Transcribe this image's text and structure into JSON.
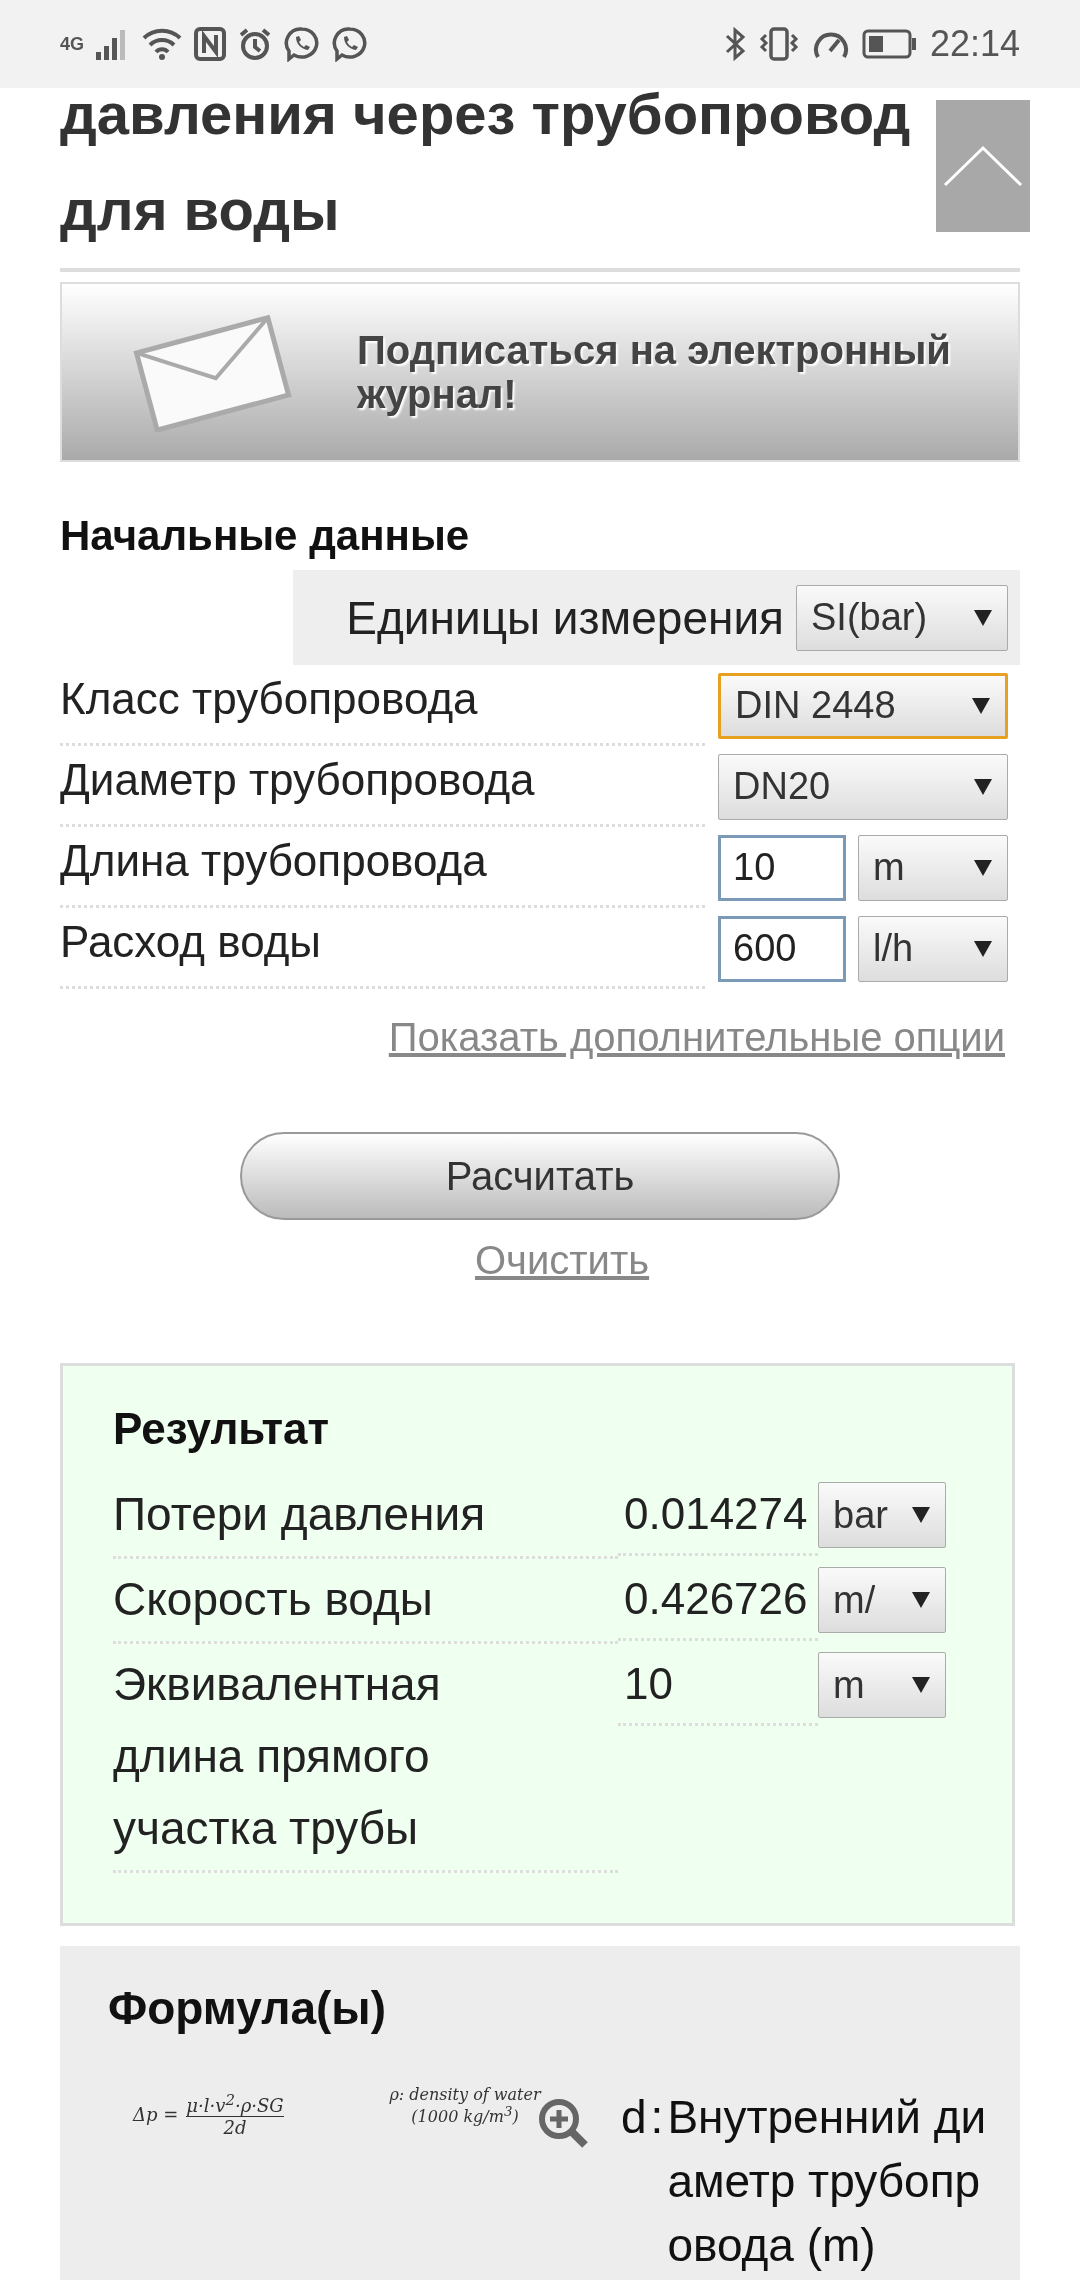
{
  "status_bar": {
    "network": "4G",
    "time": "22:14"
  },
  "title": "давления через трубопровод для воды",
  "subscribe_banner": {
    "text": "Подписаться на электронный журнал!"
  },
  "input_section": {
    "heading": "Начальные данные",
    "units": {
      "label": "Единицы измерения",
      "value": "SI(bar)"
    },
    "fields": [
      {
        "kind": "select",
        "label": "Класс трубопровода",
        "value": "DIN 2448",
        "focused": true
      },
      {
        "kind": "select",
        "label": "Диаметр трубопровода",
        "value": "DN20",
        "focused": false
      },
      {
        "kind": "input_unit",
        "label": "Длина трубопровода",
        "value": "10",
        "unit": "m",
        "focused": false
      },
      {
        "kind": "input_unit",
        "label": "Расход воды",
        "value": "600",
        "unit": "l/h",
        "focused": false
      }
    ]
  },
  "more_options_link": "Показать дополнительные опции",
  "calculate_button": "Расчитать",
  "clear_link": "Очистить",
  "result": {
    "heading": "Результат",
    "rows": [
      {
        "label": "Потери давления",
        "value": "0.014274",
        "unit": "bar"
      },
      {
        "label": "Скорость воды",
        "value": "0.426726",
        "unit": "m/"
      },
      {
        "label": "Эквивалентная длина прямого участка трубы",
        "value": "10",
        "unit": "m"
      }
    ]
  },
  "formula": {
    "heading": "Формула(ы)",
    "equation": {
      "lhs": "Δp =",
      "numerator": "μ·l·v$^{2}$·ρ·SG",
      "denominator": "2d"
    },
    "note": [
      "ρ: density of water",
      "(1000 kg/m$^{3}$)"
    ],
    "variables": [
      {
        "symbol": "d",
        "separator": ":",
        "description": "Внутренний диаметр трубопровода (m)"
      }
    ]
  }
}
